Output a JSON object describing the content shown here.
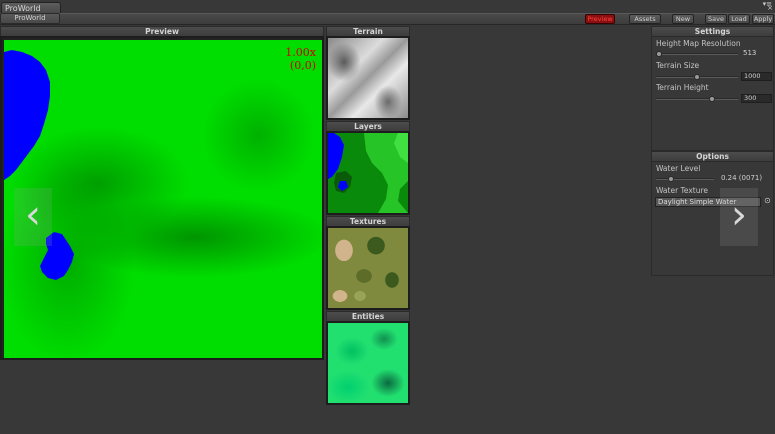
{
  "window": {
    "title_tab": "ProWorld",
    "subtab": "ProWorld",
    "menu_glyphs": "▾≡",
    "close_glyph": "×"
  },
  "toolbar": {
    "preview_label": "Preview",
    "assets_label": "Assets",
    "new_label": "New",
    "save_label": "Save",
    "load_label": "Load",
    "apply_label": "Apply"
  },
  "preview": {
    "header": "Preview",
    "zoom": "1.00x",
    "coords": "(0,0)",
    "prev_glyph": "‹",
    "next_glyph": "›"
  },
  "stages": {
    "terrain": "Terrain",
    "layers": "Layers",
    "textures": "Textures",
    "entities": "Entities"
  },
  "settings": {
    "header": "Settings",
    "height_map_resolution_label": "Height Map Resolution",
    "height_map_resolution_value": "513",
    "height_map_resolution_fraction": 0.0,
    "terrain_size_label": "Terrain Size",
    "terrain_size_value": "1000",
    "terrain_size_fraction": 0.5,
    "terrain_height_label": "Terrain Height",
    "terrain_height_value": "300",
    "terrain_height_fraction": 0.7
  },
  "options": {
    "header": "Options",
    "water_level_label": "Water Level",
    "water_level_value": "0.24 (0071)",
    "water_level_fraction": 0.24,
    "water_texture_label": "Water Texture",
    "water_texture_value": "Daylight Simple Water",
    "picker_glyph": "⊙"
  },
  "colors": {
    "background": "#383838",
    "preview_terrain": "#00dd00",
    "preview_water": "#0000ff",
    "zoom_text": "#d00000",
    "preview_button": "#8a1010"
  }
}
